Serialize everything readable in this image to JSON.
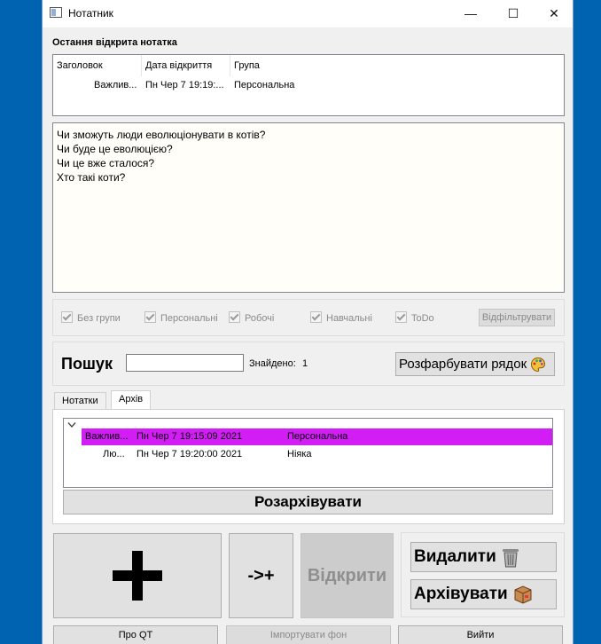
{
  "window": {
    "title": "Нотатник",
    "minimize": "—",
    "maximize": "☐",
    "close": "✕"
  },
  "recent": {
    "section_label": "Остання відкрита нотатка",
    "headers": [
      "Заголовок",
      "Дата відкриття",
      "Група"
    ],
    "row": {
      "title": "Важлив...",
      "date": "Пн Чер 7 19:19:...",
      "group": "Персональна"
    }
  },
  "editor": {
    "lines": [
      "Чи зможуть люди еволюціонувати в котів?",
      "Чи буде це еволюцією?",
      "Чи це вже сталося?",
      "Хто такі коти?"
    ]
  },
  "filters": {
    "checkboxes": [
      {
        "label": "Без групи",
        "checked": true
      },
      {
        "label": "Персональні",
        "checked": true
      },
      {
        "label": "Робочі",
        "checked": true
      },
      {
        "label": "Навчальні",
        "checked": true
      },
      {
        "label": "ToDo",
        "checked": true
      }
    ],
    "filter_button": "Відфільтрувати"
  },
  "search": {
    "label": "Пошук",
    "value": "",
    "found_label": "Знайдено:",
    "found_count": "1",
    "paint_button": "Розфарбувати рядок",
    "paint_icon": "palette-icon"
  },
  "tabs": {
    "notes": "Нотатки",
    "archive": "Архів",
    "active": "archive"
  },
  "archive": {
    "rows": [
      {
        "title": "Важлив...",
        "date": "Пн Чер 7 19:15:09 2021",
        "group": "Персональна",
        "selected": true
      },
      {
        "title": "Лю...",
        "date": "Пн Чер 7 19:20:00 2021",
        "group": "Ніяка",
        "selected": false
      }
    ],
    "highlight_color": "#d21df5",
    "unarchive_button": "Розархівувати"
  },
  "actions": {
    "add_symbol": "+",
    "add_to_label": "->+",
    "open_label": "Відкрити",
    "delete_label": "Видалити",
    "delete_icon": "trash-icon",
    "archive_label": "Архівувати",
    "archive_icon": "box-icon"
  },
  "bottom": {
    "about_qt": "Про QT",
    "import_bg": "Імпортувати фон",
    "exit": "Вийти"
  }
}
